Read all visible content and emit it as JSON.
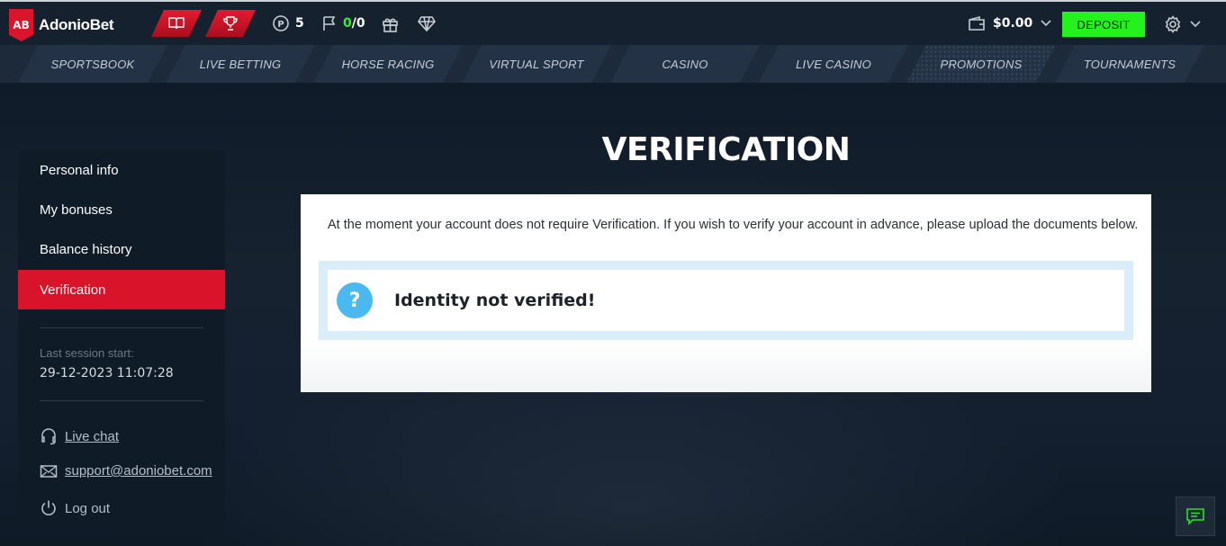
{
  "brand": {
    "logo_mark": "AB",
    "name": "AdonioBet"
  },
  "header": {
    "points": "5",
    "flags": "0",
    "flags_total": "/0",
    "balance": "$0.00",
    "deposit_label": "DEPOSIT",
    "accent_color": "#23f21d",
    "brand_color": "#d8152a"
  },
  "nav": {
    "items": [
      {
        "label": "SPORTSBOOK"
      },
      {
        "label": "LIVE BETTING"
      },
      {
        "label": "HORSE RACING"
      },
      {
        "label": "VIRTUAL SPORT"
      },
      {
        "label": "CASINO"
      },
      {
        "label": "LIVE CASINO"
      },
      {
        "label": "PROMOTIONS"
      },
      {
        "label": "TOURNAMENTS"
      }
    ]
  },
  "sidebar": {
    "items": [
      {
        "label": "Personal info"
      },
      {
        "label": "My bonuses"
      },
      {
        "label": "Balance history"
      },
      {
        "label": "Verification",
        "active": true
      }
    ],
    "session_label": "Last session start:",
    "session_value": "29-12-2023 11:07:28",
    "live_chat": "Live chat",
    "support_email": "support@adoniobet.com",
    "logout": "Log out"
  },
  "main": {
    "title": "VERIFICATION",
    "description": "At the moment your account does not require Verification. If you wish to verify your account in advance, please upload the documents below.",
    "status_text": "Identity not verified!",
    "status_icon": "?"
  }
}
